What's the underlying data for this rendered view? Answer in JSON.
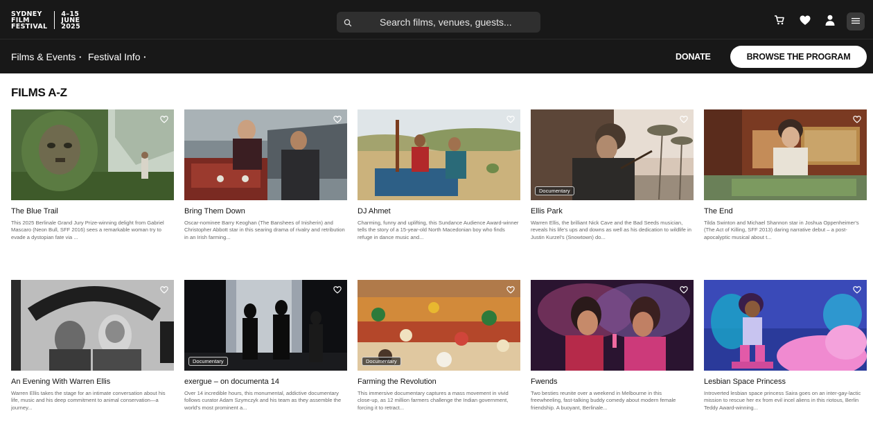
{
  "logo": {
    "line1": "SYDNEY",
    "line2": "FILM",
    "line3": "FESTIVAL",
    "date1": "4–15",
    "date2": "JUNE",
    "date3": "2025"
  },
  "search": {
    "placeholder": "Search films, venues, guests..."
  },
  "nav": {
    "films_events": "Films & Events",
    "festival_info": "Festival Info",
    "caret": "•",
    "donate": "DONATE",
    "browse": "BROWSE THE PROGRAM"
  },
  "page_title": "FILMS A-Z",
  "films": [
    {
      "title": "The Blue Trail",
      "tag": "",
      "desc": "This 2025 Berlinale Grand Jury Prize-winning delight from Gabriel Mascaro (Neon Bull, SFF 2016) sees a remarkable woman try to evade a dystopian fate via ..."
    },
    {
      "title": "Bring Them Down",
      "tag": "",
      "desc": "Oscar-nominee Barry Keoghan (The Banshees of Inisherin) and Christopher Abbott star in this searing drama of rivalry and retribution in an Irish farming..."
    },
    {
      "title": "DJ Ahmet",
      "tag": "",
      "desc": "Charming, funny and uplifting, this Sundance Audience Award-winner tells the story of a 15-year-old North Macedonian boy who finds refuge in dance music and..."
    },
    {
      "title": "Ellis Park",
      "tag": "Documentary",
      "desc": "Warren Ellis, the brilliant Nick Cave and the Bad Seeds musician, reveals his life's ups and downs as well as his dedication to wildlife in Justin Kurzel's (Snowtown) do..."
    },
    {
      "title": "The End",
      "tag": "",
      "desc": "Tilda Swinton and Michael Shannon star in Joshua Oppenheimer's (The Act of Killing, SFF 2013) daring narrative debut – a post-apocalyptic musical about t..."
    },
    {
      "title": "An Evening With Warren Ellis",
      "tag": "",
      "desc": "Warren Ellis takes the stage for an intimate conversation about his life, music and his deep commitment to animal conservation—a journey..."
    },
    {
      "title": "exergue – on documenta 14",
      "tag": "Documentary",
      "desc": "Over 14 incredible hours, this monumental, addictive documentary follows curator Adam Szymczyk and his team as they assemble the world's most prominent a..."
    },
    {
      "title": "Farming the Revolution",
      "tag": "Documentary",
      "desc": "This immersive documentary captures a mass movement in vivid close-up, as 12 million farmers challenge the Indian government, forcing it to retract..."
    },
    {
      "title": "Fwends",
      "tag": "",
      "desc": "Two besties reunite over a weekend in Melbourne in this freewheeling, fast-talking buddy comedy about modern female friendship. A buoyant, Berlinale..."
    },
    {
      "title": "Lesbian Space Princess",
      "tag": "",
      "desc": "Introverted lesbian space princess Saira goes on an inter-gay-lactic mission to rescue her ex from evil incel aliens in this riotous, Berlin Teddy Award-winning..."
    }
  ],
  "colors": {
    "bar": "#181818",
    "search_bg": "#2f2f2f",
    "text_muted": "#666666"
  }
}
